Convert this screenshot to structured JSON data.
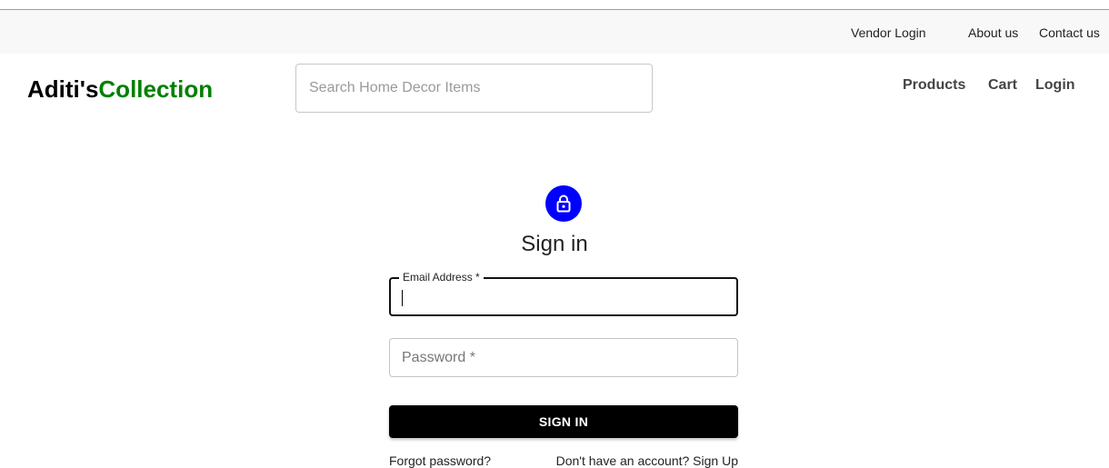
{
  "topbar": {
    "vendor_login": "Vendor Login",
    "about_us": "About us",
    "contact_us": "Contact us"
  },
  "brand": {
    "part1": "Aditi's",
    "part2": "Collection"
  },
  "search": {
    "placeholder": "Search Home Decor Items",
    "value": ""
  },
  "nav": {
    "products": "Products",
    "cart": "Cart",
    "login": "Login"
  },
  "signin_form": {
    "icon": "lock-icon",
    "title": "Sign in",
    "email_label": "Email Address *",
    "email_value": "",
    "password_placeholder": "Password *",
    "password_value": "",
    "submit_label": "SIGN IN",
    "forgot_password": "Forgot password?",
    "signup_link": "Don't have an account? Sign Up"
  },
  "colors": {
    "brand_accent": "#008000",
    "lock_avatar": "#0000ff",
    "button_bg": "#000000"
  }
}
